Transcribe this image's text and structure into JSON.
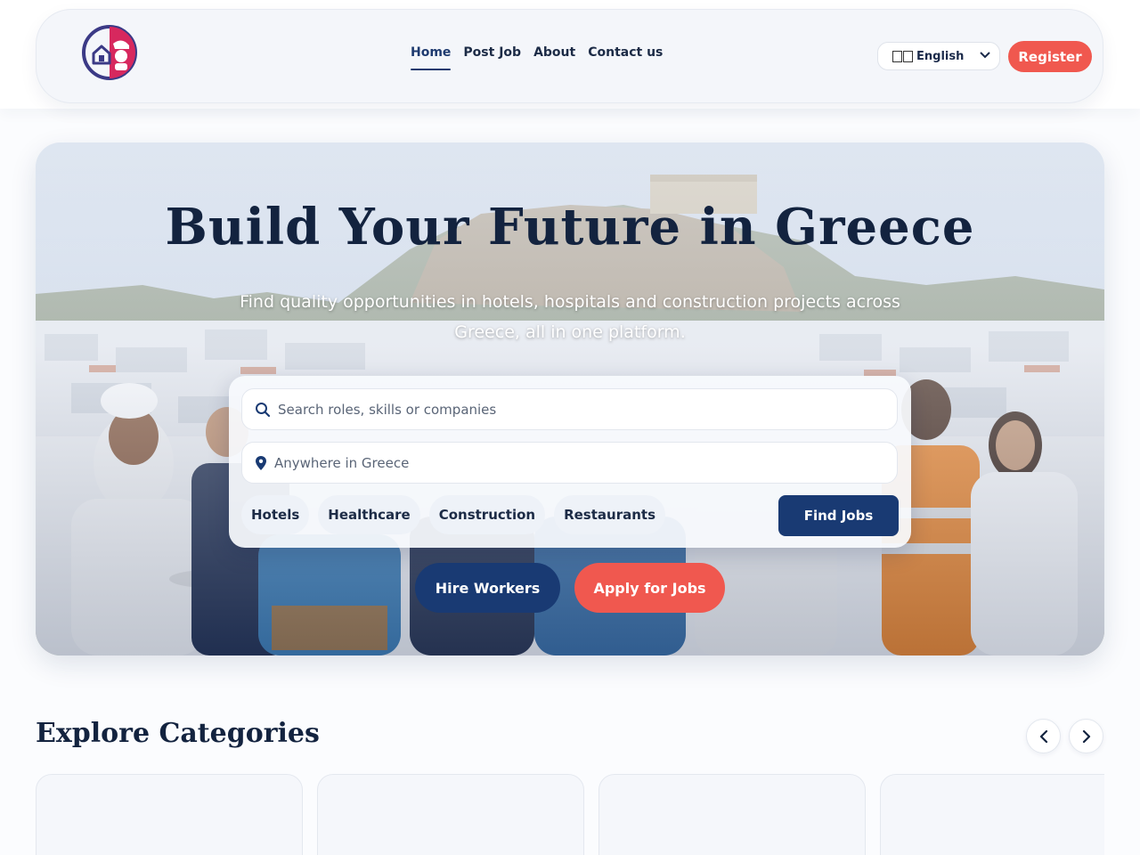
{
  "header": {
    "nav": [
      {
        "label": "Home",
        "active": true
      },
      {
        "label": "Post Job",
        "active": false
      },
      {
        "label": "About",
        "active": false
      },
      {
        "label": "Contact us",
        "active": false
      }
    ],
    "language": {
      "selected": "English"
    },
    "register_label": "Register"
  },
  "hero": {
    "title": "Build Your Future in Greece",
    "subtitle": "Find quality opportunities in hotels, hospitals and construction projects across Greece, all in one platform.",
    "search": {
      "role_placeholder": "Search roles, skills or companies",
      "location_placeholder": "Anywhere in Greece"
    },
    "chips": [
      "Hotels",
      "Healthcare",
      "Construction",
      "Restaurants"
    ],
    "find_label": "Find Jobs",
    "hire_label": "Hire Workers",
    "apply_label": "Apply for Jobs"
  },
  "categories": {
    "title": "Explore Categories"
  },
  "colors": {
    "navy": "#193a73",
    "coral": "#f0584f",
    "heading": "#13233f"
  },
  "icons": [
    "brand-logo-icon",
    "search-icon",
    "location-pin-icon",
    "chevron-down-icon",
    "chevron-left-icon",
    "chevron-right-icon"
  ]
}
